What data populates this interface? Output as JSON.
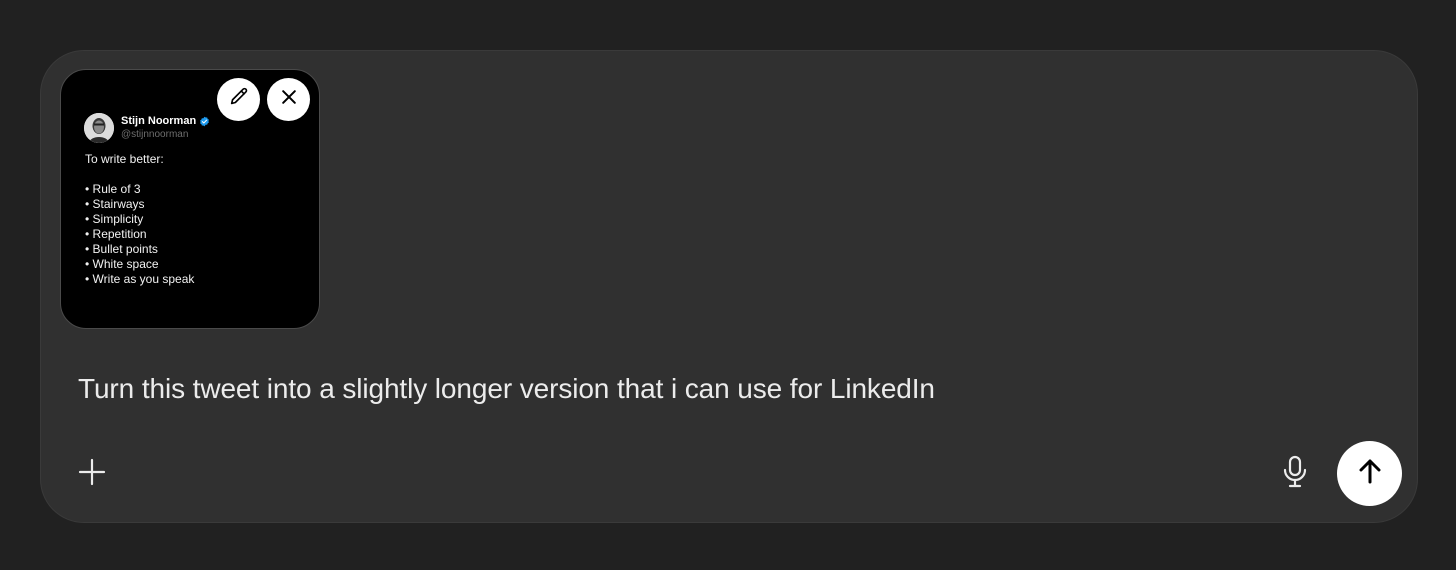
{
  "attachment": {
    "author_name": "Stijn Noorman",
    "handle": "@stijnnoorman",
    "verified": true,
    "intro": "To write better:",
    "items": [
      "Rule of 3",
      "Stairways",
      "Simplicity",
      "Repetition",
      "Bullet points",
      "White space",
      "Write as you speak"
    ],
    "edit_icon": "pencil-icon",
    "close_icon": "close-icon"
  },
  "composer": {
    "text": "Turn this tweet into a slightly longer version that i can use for LinkedIn",
    "add_icon": "plus-icon",
    "mic_icon": "microphone-icon",
    "send_icon": "arrow-up-icon"
  },
  "colors": {
    "page_background": "#212121",
    "composer_background": "#303030",
    "verified_badge": "#1d9bf0",
    "send_button": "#ffffff"
  }
}
